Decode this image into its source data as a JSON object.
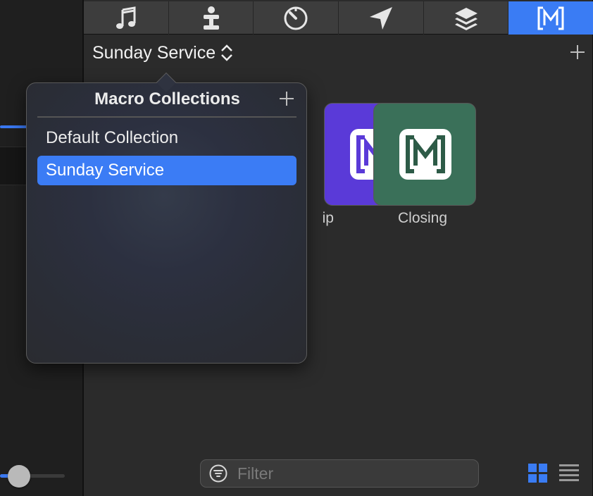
{
  "tabs": [
    {
      "icon": "music-note-icon",
      "active": false
    },
    {
      "icon": "presenter-icon",
      "active": false
    },
    {
      "icon": "timer-icon",
      "active": false
    },
    {
      "icon": "send-icon",
      "active": false
    },
    {
      "icon": "layers-icon",
      "active": false
    },
    {
      "icon": "macro-icon",
      "active": true
    }
  ],
  "header": {
    "collection_name": "Sunday Service",
    "chevron_icon": "up-down-chevron-icon",
    "add_icon": "plus-icon"
  },
  "macros": [
    {
      "label": "ip",
      "color": "#5a3ad8",
      "icon": "macro-icon"
    },
    {
      "label": "Closing",
      "color": "#3a7059",
      "icon": "macro-icon"
    }
  ],
  "popover": {
    "title": "Macro Collections",
    "add_icon": "plus-icon",
    "items": [
      {
        "label": "Default Collection",
        "selected": false
      },
      {
        "label": "Sunday Service",
        "selected": true
      }
    ]
  },
  "filter": {
    "placeholder": "Filter",
    "value": "",
    "icon": "filter-icon"
  },
  "view_mode": {
    "grid_icon": "grid-view-icon",
    "list_icon": "list-view-icon",
    "active": "grid"
  },
  "colors": {
    "accent": "#3a7cf4",
    "background": "#2b2b2b",
    "tab_bar": "#3d3d3d"
  }
}
